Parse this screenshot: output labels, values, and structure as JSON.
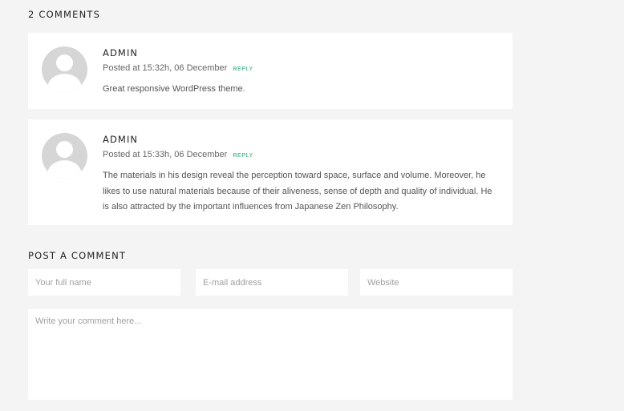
{
  "comments_section": {
    "title": "2 COMMENTS",
    "comments": [
      {
        "author": "ADMIN",
        "posted": "Posted at 15:32h, 06 December",
        "reply_label": "REPLY",
        "text": "Great responsive WordPress theme."
      },
      {
        "author": "ADMIN",
        "posted": "Posted at 15:33h, 06 December",
        "reply_label": "REPLY",
        "text": "The materials in his design reveal the perception toward space, surface and volume. Moreover, he likes to use natural materials because of their aliveness, sense of depth and quality of individual. He is also attracted by the important influences from Japanese Zen Philosophy."
      }
    ]
  },
  "comment_form": {
    "title": "POST A COMMENT",
    "name_placeholder": "Your full name",
    "email_placeholder": "E-mail address",
    "website_placeholder": "Website",
    "comment_placeholder": "Write your comment here..."
  },
  "colors": {
    "background": "#f4f4f4",
    "card": "#ffffff",
    "reply_accent": "#1f9e6a",
    "avatar": "#d6d6d6"
  }
}
